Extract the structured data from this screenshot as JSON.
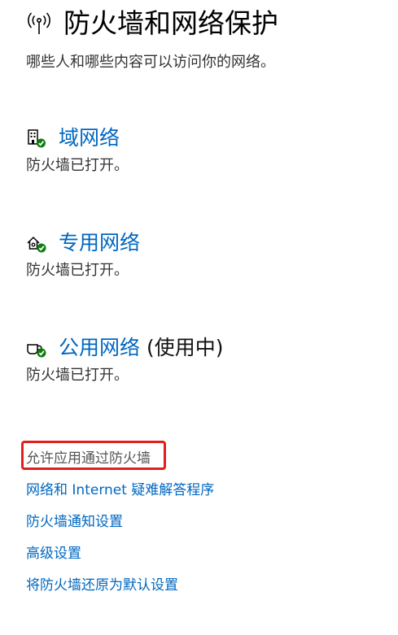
{
  "header": {
    "icon": "antenna-icon",
    "title": "防火墙和网络保护"
  },
  "subtitle": "哪些人和哪些内容可以访问你的网络。",
  "networks": [
    {
      "icon": "domain-network-icon",
      "name": "域网络",
      "active_label": "",
      "status": "防火墙已打开。"
    },
    {
      "icon": "private-network-icon",
      "name": "专用网络",
      "active_label": "",
      "status": "防火墙已打开。"
    },
    {
      "icon": "public-network-icon",
      "name": "公用网络",
      "active_label": "(使用中)",
      "status": "防火墙已打开。"
    }
  ],
  "links": [
    {
      "label": "允许应用通过防火墙",
      "highlighted": true
    },
    {
      "label": "网络和 Internet 疑难解答程序",
      "highlighted": false
    },
    {
      "label": "防火墙通知设置",
      "highlighted": false
    },
    {
      "label": "高级设置",
      "highlighted": false
    },
    {
      "label": "将防火墙还原为默认设置",
      "highlighted": false
    }
  ],
  "colors": {
    "link": "#0067c0",
    "check_green": "#107c10",
    "highlight_border": "#e0201c"
  }
}
